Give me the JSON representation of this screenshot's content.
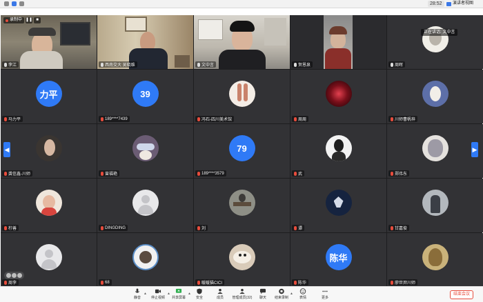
{
  "topbar": {
    "time": "28:52",
    "presenter_label": "演讲者视图"
  },
  "recording": {
    "label": "录制中",
    "pause_icon": "pause-icon",
    "stop_icon": "stop-icon"
  },
  "speaking": "正在讲话: 文中言",
  "tiles": [
    {
      "name": "李江"
    },
    {
      "name": "西南交大 吴晓维"
    },
    {
      "name": "文中言"
    },
    {
      "name": "贺恩泉"
    },
    {
      "name": "周晖"
    },
    {
      "name": "马力平",
      "avatar_text": "力平"
    },
    {
      "name": "189****7439",
      "avatar_text": "39"
    },
    {
      "name": "冯石-四川美术馆"
    },
    {
      "name": "周周"
    },
    {
      "name": "川师曹帆梓"
    },
    {
      "name": "龚信鑫-川师"
    },
    {
      "name": "曾福艳"
    },
    {
      "name": "189****3579",
      "avatar_text": "79"
    },
    {
      "name": "武"
    },
    {
      "name": "郑伟东"
    },
    {
      "name": "柠善"
    },
    {
      "name": "DINGDING"
    },
    {
      "name": "刘"
    },
    {
      "name": "谭"
    },
    {
      "name": "甘嘉俊"
    },
    {
      "name": "周李"
    },
    {
      "name": "68"
    },
    {
      "name": "暖暖猫CICI"
    },
    {
      "name": "陈华",
      "avatar_text": "陈华"
    },
    {
      "name": "廖世羿川师"
    }
  ],
  "toolbar": {
    "items": [
      {
        "label": "静音",
        "icon": "microphone-icon"
      },
      {
        "label": "停止视频",
        "icon": "camera-icon"
      },
      {
        "label": "共享屏幕",
        "icon": "share-screen-icon"
      },
      {
        "label": "安全",
        "icon": "shield-icon"
      },
      {
        "label": "成员",
        "icon": "members-icon"
      },
      {
        "label": "管理成员(32)",
        "icon": "manage-members-icon"
      },
      {
        "label": "聊天",
        "icon": "chat-icon"
      },
      {
        "label": "结束录制",
        "icon": "record-stop-icon"
      },
      {
        "label": "表情",
        "icon": "emoji-icon"
      },
      {
        "label": "更多",
        "icon": "more-icon"
      }
    ],
    "end_meeting": "结束会议"
  },
  "colors": {
    "accent": "#2f7af6",
    "active_border": "#48c35a",
    "end_red": "#e74c3c"
  }
}
